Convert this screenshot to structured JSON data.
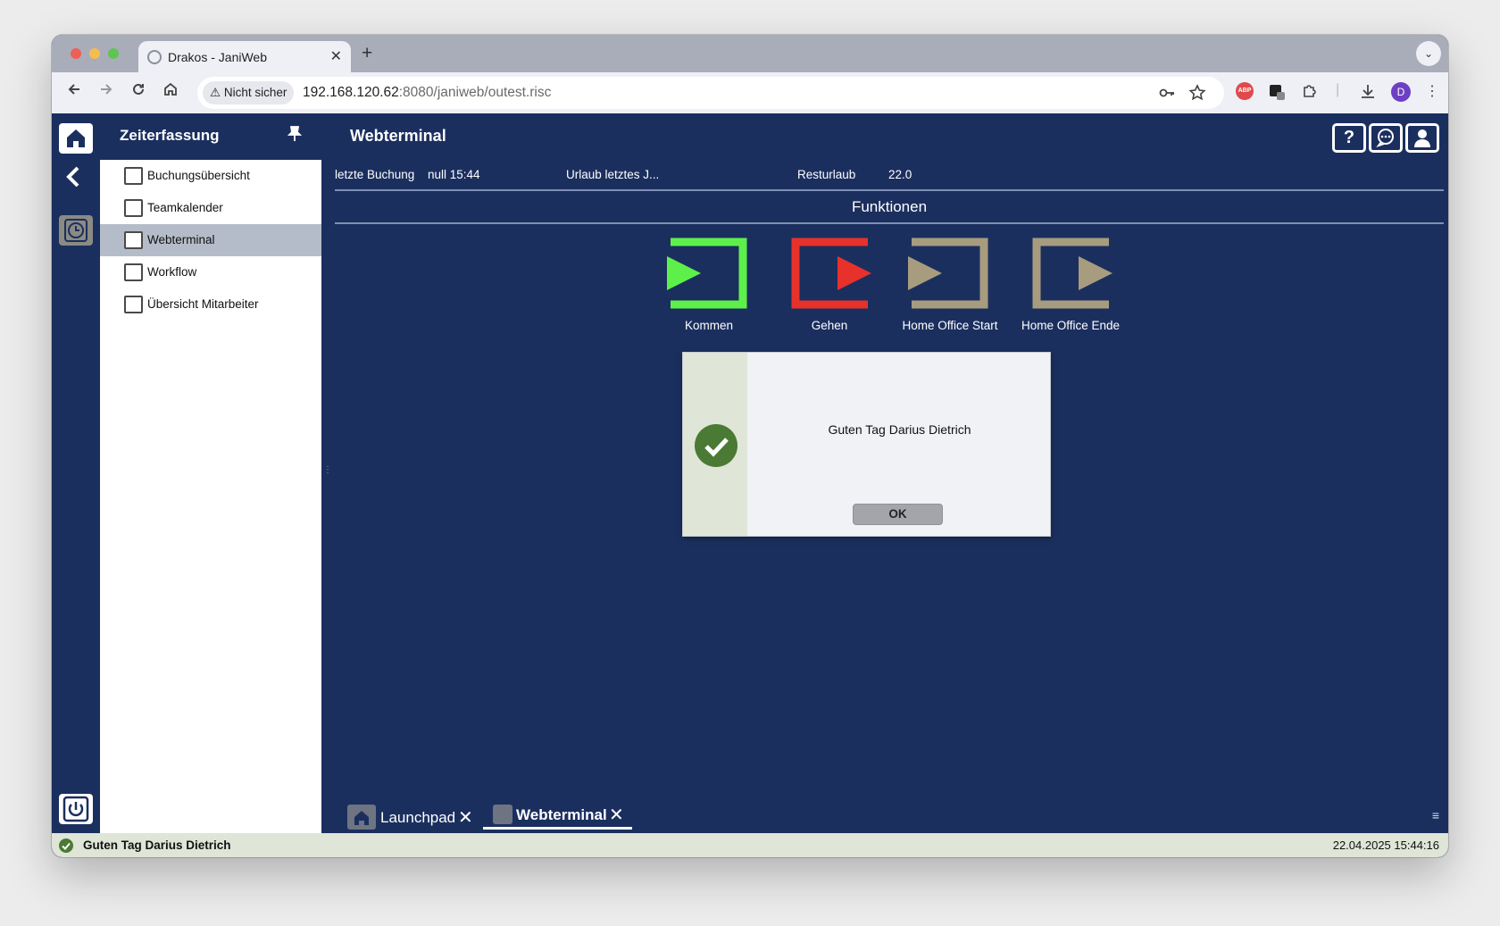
{
  "browser": {
    "tab_title": "Drakos - JaniWeb",
    "tab_close": "✕",
    "new_tab": "+",
    "tab_search": "⌄",
    "security_label": "Nicht sicher",
    "url_host": "192.168.120.62",
    "url_rest": ":8080/janiweb/outest.risc",
    "profile_initial": "D",
    "abp_label": "ABP"
  },
  "app": {
    "title": "Zeiterfassung",
    "view_title": "Webterminal",
    "top_buttons": {
      "help": "?"
    }
  },
  "sidebar": {
    "items": [
      {
        "label": "Buchungsübersicht"
      },
      {
        "label": "Teamkalender"
      },
      {
        "label": "Webterminal"
      },
      {
        "label": "Workflow"
      },
      {
        "label": "Übersicht Mitarbeiter"
      }
    ]
  },
  "info": {
    "last_booking_label": "letzte Buchung",
    "last_booking_value": "null 15:44",
    "vacation_label": "Urlaub letztes J...",
    "rest_label": "Resturlaub",
    "rest_value": "22.0"
  },
  "functions": {
    "title": "Funktionen",
    "items": [
      {
        "label": "Kommen",
        "color": "#5ef04a"
      },
      {
        "label": "Gehen",
        "color": "#e6322a"
      },
      {
        "label": "Home Office Start",
        "color": "#a89c7f"
      },
      {
        "label": "Home Office Ende",
        "color": "#a89c7f"
      }
    ]
  },
  "dialog": {
    "message": "Guten Tag Darius Dietrich",
    "ok_label": "OK"
  },
  "bottom_tabs": [
    {
      "label": "Launchpad",
      "close": "✕"
    },
    {
      "label": "Webterminal",
      "close": "✕"
    }
  ],
  "status": {
    "message": "Guten Tag Darius Dietrich",
    "datetime": "22.04.2025 15:44:16"
  },
  "colors": {
    "app_bg": "#1b2f5f",
    "status_ok": "#4a7a33"
  }
}
